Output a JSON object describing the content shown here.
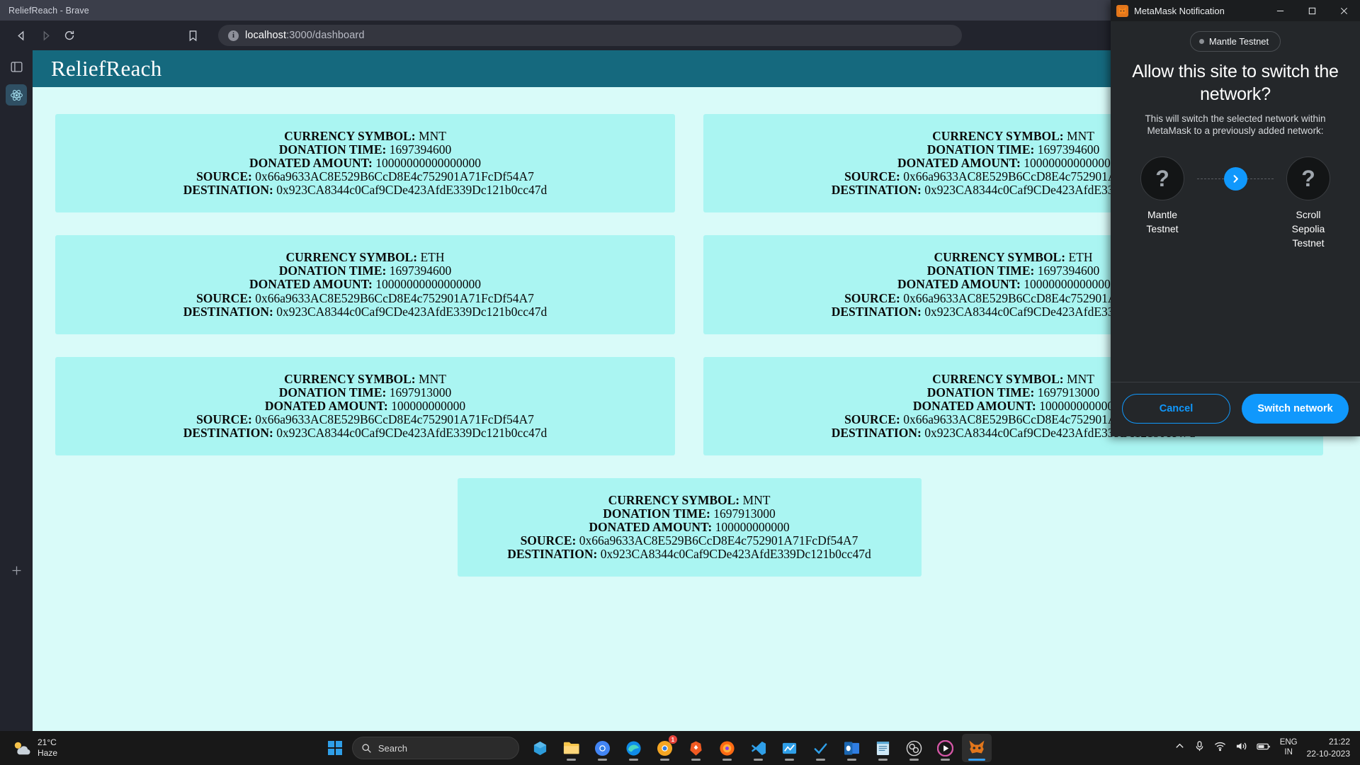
{
  "browser": {
    "window_title": "ReliefReach - Brave",
    "back_icon": "back-arrow-icon",
    "forward_icon": "forward-arrow-icon",
    "reload_icon": "reload-icon",
    "bookmark_icon": "bookmark-icon",
    "site_info_char": "i",
    "url_host": "localhost",
    "url_path": ":3000/dashboard",
    "extension_badge_count": "1",
    "sidebar": {
      "panel_icon": "sidebar-panel-icon",
      "react_icon": "react-devtools-icon",
      "add_icon": "add-icon"
    }
  },
  "page": {
    "app_title": "ReliefReach",
    "labels": {
      "currency_symbol": "CURRENCY SYMBOL:",
      "donation_time": "DONATION TIME:",
      "donated_amount": "DONATED AMOUNT:",
      "source": "SOURCE:",
      "destination": "DESTINATION:"
    },
    "cards": [
      {
        "currency_symbol": "MNT",
        "donation_time": "1697394600",
        "donated_amount": "10000000000000000",
        "source": "0x66a9633AC8E529B6CcD8E4c752901A71FcDf54A7",
        "destination": "0x923CA8344c0Caf9CDe423AfdE339Dc121b0cc47d"
      },
      {
        "currency_symbol": "MNT",
        "donation_time": "1697394600",
        "donated_amount": "10000000000000000",
        "source": "0x66a9633AC8E529B6CcD8E4c752901A71FcDf54A7",
        "destination": "0x923CA8344c0Caf9CDe423AfdE339Dc121b0cc47d"
      },
      {
        "currency_symbol": "ETH",
        "donation_time": "1697394600",
        "donated_amount": "10000000000000000",
        "source": "0x66a9633AC8E529B6CcD8E4c752901A71FcDf54A7",
        "destination": "0x923CA8344c0Caf9CDe423AfdE339Dc121b0cc47d"
      },
      {
        "currency_symbol": "ETH",
        "donation_time": "1697394600",
        "donated_amount": "10000000000000000",
        "source": "0x66a9633AC8E529B6CcD8E4c752901A71FcDf54A7",
        "destination": "0x923CA8344c0Caf9CDe423AfdE339Dc121b0cc47d"
      },
      {
        "currency_symbol": "MNT",
        "donation_time": "1697913000",
        "donated_amount": "100000000000",
        "source": "0x66a9633AC8E529B6CcD8E4c752901A71FcDf54A7",
        "destination": "0x923CA8344c0Caf9CDe423AfdE339Dc121b0cc47d"
      },
      {
        "currency_symbol": "MNT",
        "donation_time": "1697913000",
        "donated_amount": "100000000000",
        "source": "0x66a9633AC8E529B6CcD8E4c752901A71FcDf54A7",
        "destination": "0x923CA8344c0Caf9CDe423AfdE339Dc121b0cc47d"
      }
    ],
    "last_card": {
      "currency_symbol": "MNT",
      "donation_time": "1697913000",
      "donated_amount": "100000000000",
      "source": "0x66a9633AC8E529B6CcD8E4c752901A71FcDf54A7",
      "destination": "0x923CA8344c0Caf9CDe423AfdE339Dc121b0cc47d"
    },
    "colors": {
      "header_bg": "#15697e",
      "page_bg": "#d9fbf9",
      "card_bg": "#aaf5f2"
    }
  },
  "metamask": {
    "window_title": "MetaMask Notification",
    "minimize_label": "—",
    "maximize_label": "□",
    "close_label": "✕",
    "network_pill": "Mantle Testnet",
    "heading": "Allow this site to switch the network?",
    "subtext": "This will switch the selected network within MetaMask to a previously added network:",
    "from_network": "Mantle Testnet",
    "to_network": "Scroll Sepolia Testnet",
    "unknown_icon_char": "?",
    "arrow_icon": "chevron-right-icon",
    "cancel_label": "Cancel",
    "switch_label": "Switch network",
    "accent_color": "#1098fc"
  },
  "taskbar": {
    "weather_temp": "21°C",
    "weather_desc": "Haze",
    "start_icon": "windows-start-icon",
    "search_placeholder": "Search",
    "apps": [
      {
        "name": "store-icon",
        "badge": "",
        "active": false
      },
      {
        "name": "file-explorer-icon",
        "badge": "",
        "active": true
      },
      {
        "name": "chrome-icon",
        "badge": "",
        "active": true
      },
      {
        "name": "edge-icon",
        "badge": "",
        "active": true
      },
      {
        "name": "chrome-canary-icon",
        "badge": "1",
        "active": true
      },
      {
        "name": "brave-icon",
        "badge": "",
        "active": true
      },
      {
        "name": "firefox-icon",
        "badge": "",
        "active": true
      },
      {
        "name": "vscode-icon",
        "badge": "",
        "active": true
      },
      {
        "name": "azure-data-studio-icon",
        "badge": "",
        "active": true
      },
      {
        "name": "todo-icon",
        "badge": "",
        "active": true
      },
      {
        "name": "outlook-icon",
        "badge": "",
        "active": true
      },
      {
        "name": "notepad-icon",
        "badge": "",
        "active": true
      },
      {
        "name": "obs-icon",
        "badge": "",
        "active": true
      },
      {
        "name": "media-player-icon",
        "badge": "",
        "active": true
      },
      {
        "name": "metamask-icon",
        "badge": "",
        "active": true
      }
    ],
    "show_hidden_icon": "chevron-up-icon",
    "mic_icon": "microphone-icon",
    "wifi_icon": "wifi-icon",
    "volume_icon": "volume-icon",
    "battery_icon": "battery-icon",
    "language_line1": "ENG",
    "language_line2": "IN",
    "clock_time": "21:22",
    "clock_date": "22-10-2023"
  }
}
